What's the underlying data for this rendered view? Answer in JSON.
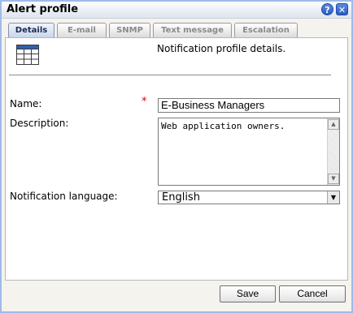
{
  "window": {
    "title": "Alert profile",
    "help_label": "?",
    "close_label": "✕"
  },
  "tabs": [
    {
      "label": "Details",
      "active": true
    },
    {
      "label": "E-mail",
      "active": false
    },
    {
      "label": "SNMP",
      "active": false
    },
    {
      "label": "Text message",
      "active": false
    },
    {
      "label": "Escalation",
      "active": false
    }
  ],
  "details": {
    "intro": "Notification profile details.",
    "icon": "grid-icon",
    "name_label": "Name:",
    "required_marker": "*",
    "name_value": "E-Business Managers",
    "description_label": "Description:",
    "description_value": "Web application owners.",
    "language_label": "Notification language:",
    "language_value": "English"
  },
  "footer": {
    "save_label": "Save",
    "cancel_label": "Cancel"
  },
  "colors": {
    "accent": "#2a5bc3",
    "required": "#d40000",
    "active_tab_text": "#1a2b56"
  }
}
